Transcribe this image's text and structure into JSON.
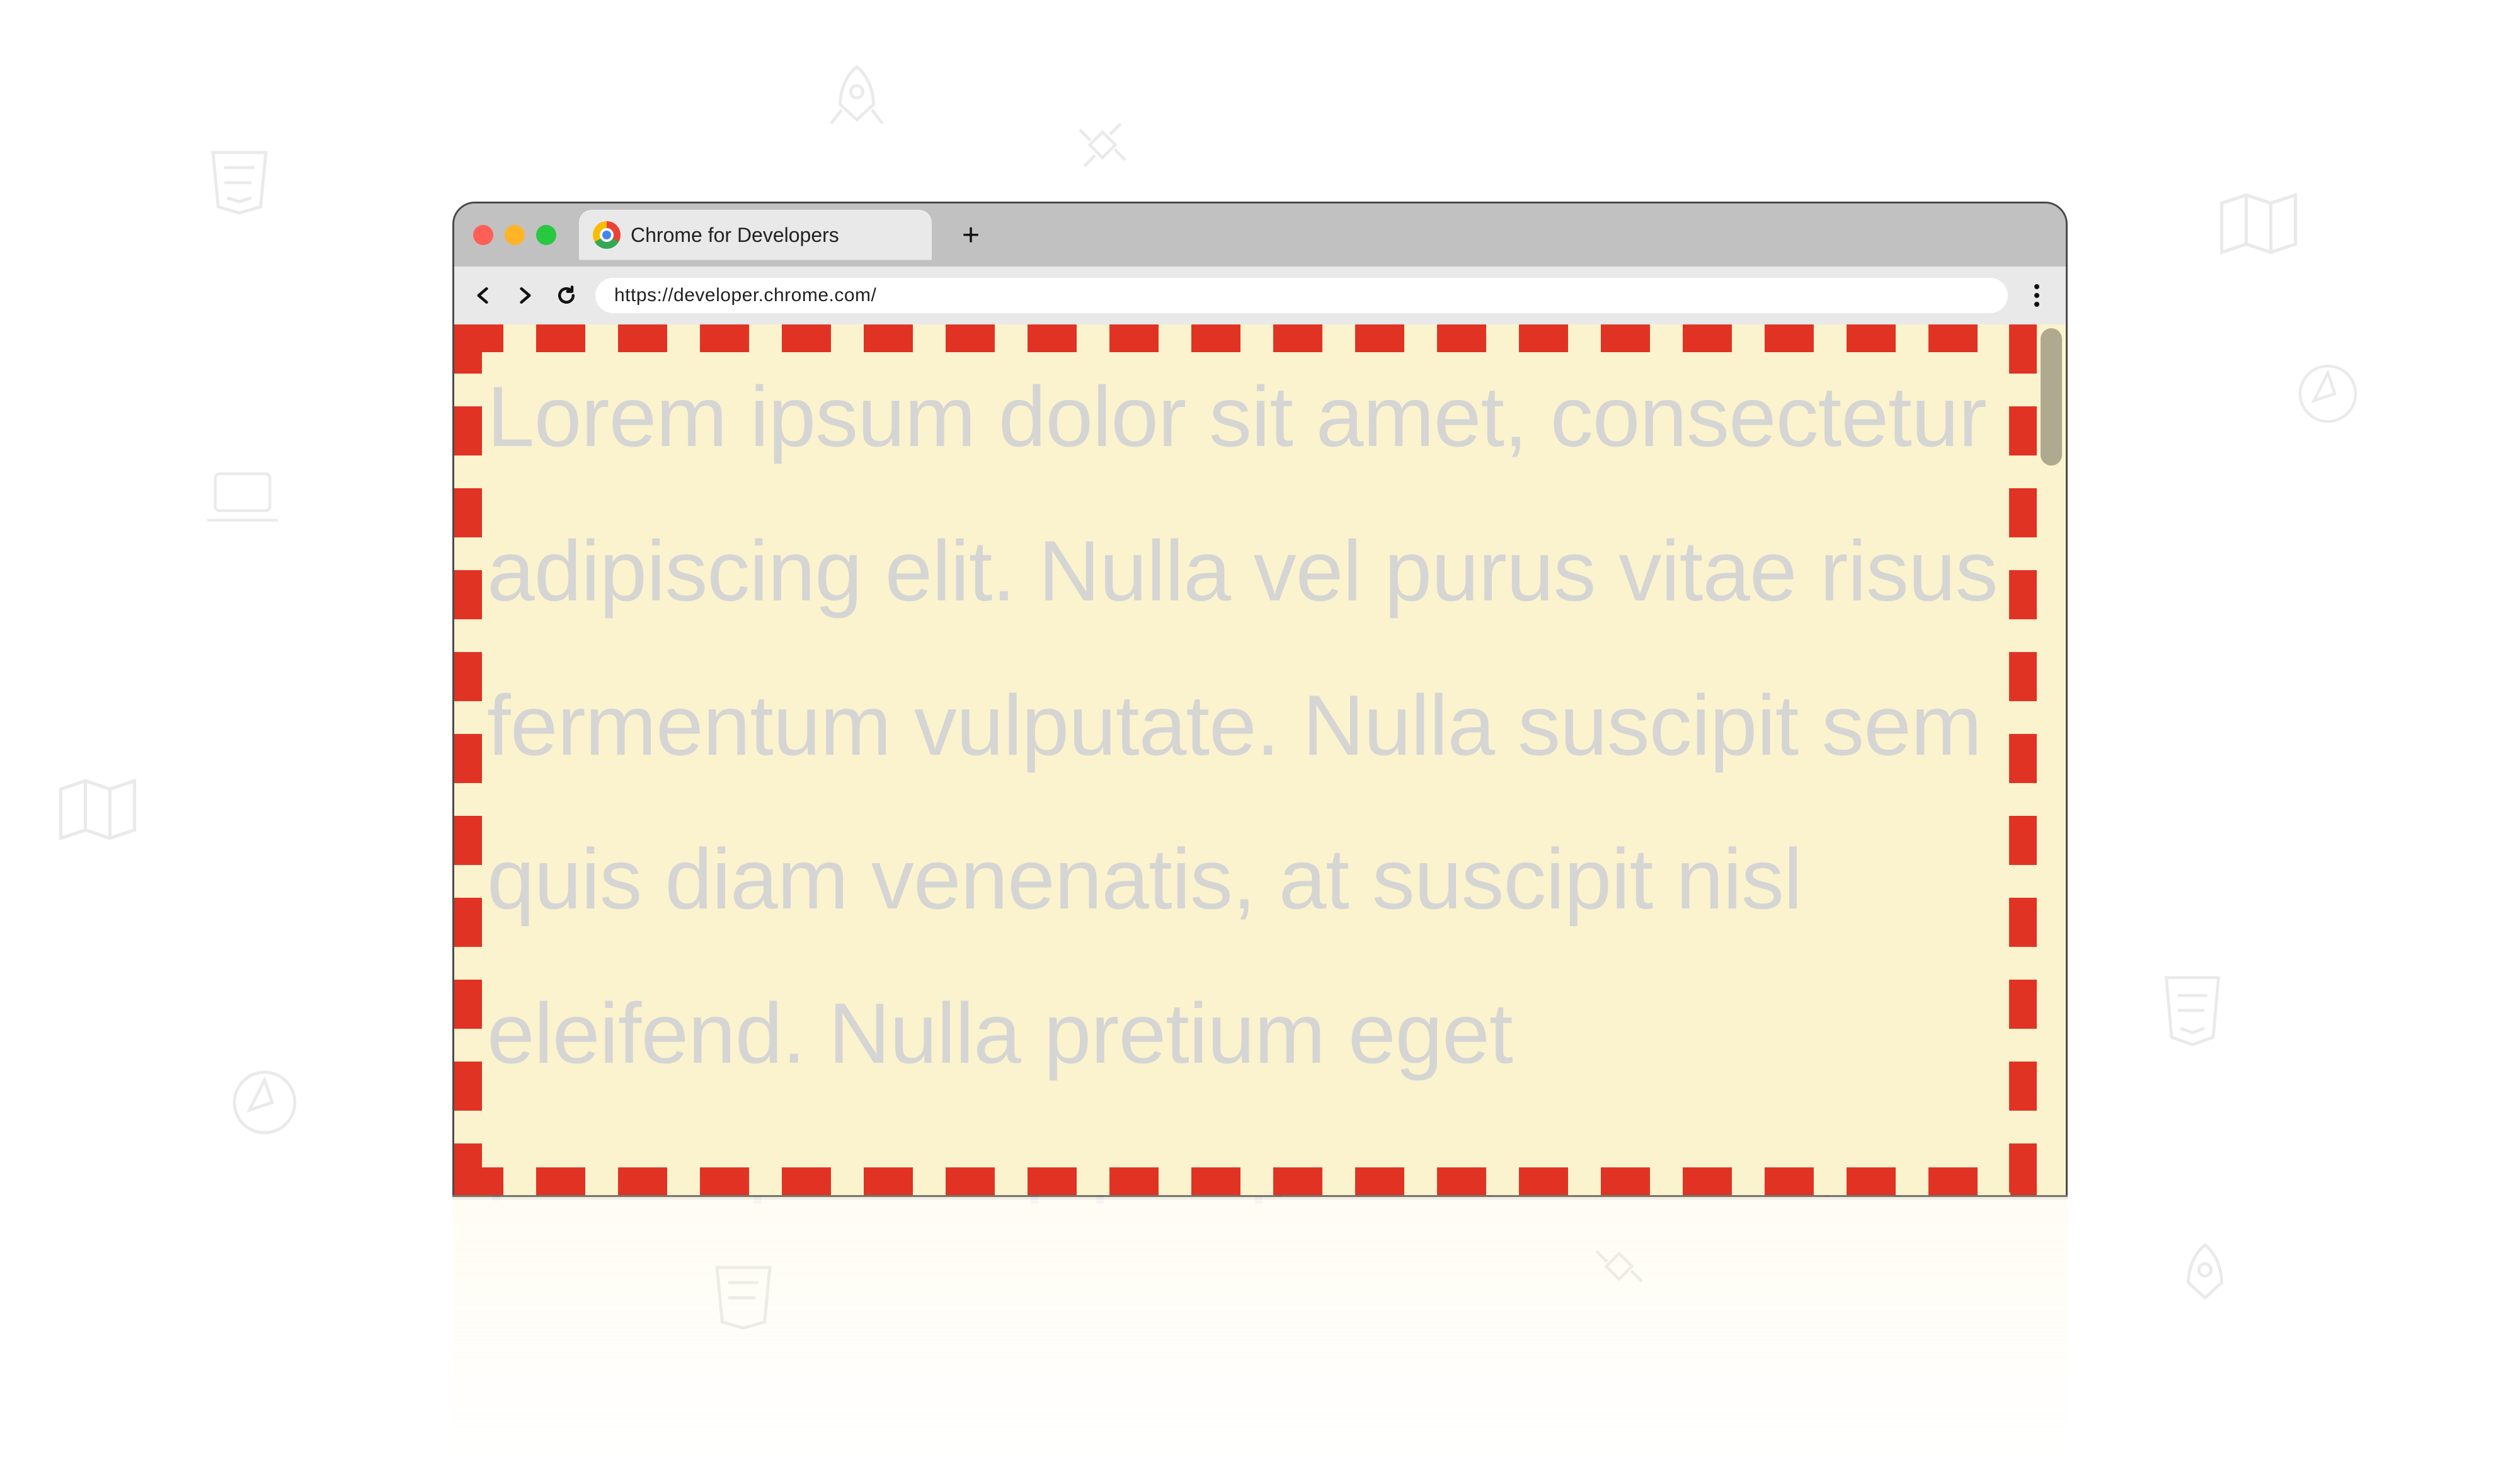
{
  "browser": {
    "tab_title": "Chrome for Developers",
    "new_tab_label": "+",
    "url": "https://developer.chrome.com/"
  },
  "page": {
    "body_text": "Lorem ipsum dolor sit amet, consectetur adipiscing elit. Nulla vel purus vitae risus fermentum vulputate. Nulla suscipit sem quis diam venenatis, at suscipit nisl eleifend. Nulla pretium eget"
  },
  "colors": {
    "viewport_bg": "#fbf3ce",
    "dash": "#e13324",
    "text": "#d5d5d4"
  }
}
